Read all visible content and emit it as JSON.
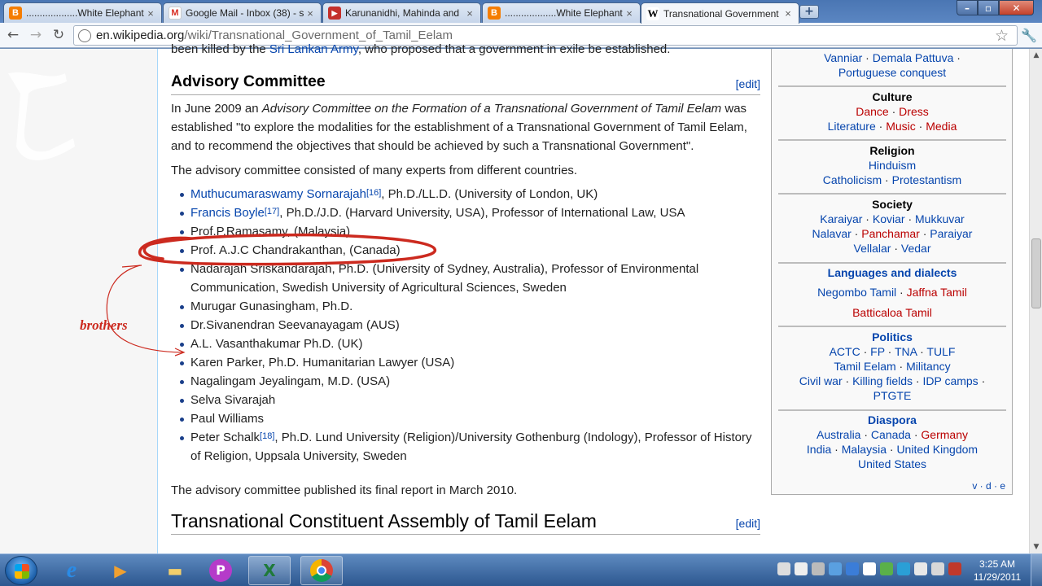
{
  "browser": {
    "tabs": [
      {
        "title": "...................White Elephant",
        "icon": "blogger-icon",
        "color": "#f57d00",
        "glyph": "B"
      },
      {
        "title": "Google Mail - Inbox (38) - s",
        "icon": "gmail-icon",
        "color": "#d93025",
        "glyph": "M"
      },
      {
        "title": "Karunanidhi, Mahinda and",
        "icon": "youtube-icon",
        "color": "#c4302b",
        "glyph": "▶"
      },
      {
        "title": "...................White Elephant",
        "icon": "blogger-icon",
        "color": "#f57d00",
        "glyph": "B"
      },
      {
        "title": "Transnational Government",
        "icon": "wikipedia-icon",
        "color": "#ffffff",
        "glyph": "W"
      }
    ],
    "url_host": "en.wikipedia.org",
    "url_path": "/wiki/Transnational_Government_of_Tamil_Eelam"
  },
  "article": {
    "top_line": {
      "pre": "been killed by the ",
      "link": "Sri Lankan Army",
      "post": ", who proposed that a government in exile be established."
    },
    "section1": {
      "title": "Advisory Committee",
      "edit": "[edit]"
    },
    "para1": {
      "pre": "In June 2009 an ",
      "italic": "Advisory Committee on the Formation of a Transnational Government of Tamil Eelam",
      "post": " was established \"to explore the modalities for the establishment of a Transnational Government of Tamil Eelam, and to recommend the objectives that should be achieved by such a Transnational Government\"."
    },
    "para2": "The advisory committee consisted of many experts from different countries.",
    "members": [
      {
        "link": "Muthucumaraswamy Sornarajah",
        "ref": "[16]",
        "text": ", Ph.D./LL.D. (University of London, UK)"
      },
      {
        "link": "Francis Boyle",
        "ref": "[17]",
        "text": ", Ph.D./J.D. (Harvard University, USA), Professor of International Law, USA"
      },
      {
        "text": "Prof.P.Ramasamy, (Malaysia)"
      },
      {
        "text": "Prof. A.J.C Chandrakanthan, (Canada)"
      },
      {
        "text": "Nadarajah Sriskandarajah, Ph.D. (University of Sydney, Australia), Professor of Environmental Communication, Swedish University of Agricultural Sciences, Sweden"
      },
      {
        "text": "Murugar Gunasingham, Ph.D."
      },
      {
        "text": "Dr.Sivanendran Seevanayagam (AUS)"
      },
      {
        "text": "A.L. Vasanthakumar Ph.D. (UK)"
      },
      {
        "text": "Karen Parker, Ph.D. Humanitarian Lawyer (USA)"
      },
      {
        "text": "Nagalingam Jeyalingam, M.D. (USA)"
      },
      {
        "text": "Selva Sivarajah"
      },
      {
        "text": "Paul Williams"
      },
      {
        "text": "Peter Schalk",
        "ref": "[18]",
        "text2": ", Ph.D. Lund University (Religion)/University Gothenburg (Indology), Professor of History of Religion, Uppsala University, Sweden"
      }
    ],
    "para3": "The advisory committee published its final report in March 2010.",
    "section2": {
      "title": "Transnational Constituent Assembly of Tamil Eelam",
      "edit": "[edit]"
    },
    "annotation": "brothers",
    "annotation_color": "#cc2a1f"
  },
  "navbox": {
    "history": {
      "row1": [
        "Vanniar",
        "Demala Pattuva"
      ],
      "row2": [
        "Portuguese conquest"
      ]
    },
    "culture": {
      "title": "Culture",
      "row1": [
        "Dance",
        "Dress"
      ],
      "row2": [
        "Literature",
        "Music",
        "Media"
      ]
    },
    "religion": {
      "title": "Religion",
      "row1": [
        "Hinduism"
      ],
      "row2": [
        "Catholicism",
        "Protestantism"
      ]
    },
    "society": {
      "title": "Society",
      "row1": [
        "Karaiyar",
        "Koviar",
        "Mukkuvar"
      ],
      "row2": [
        "Nalavar",
        "Panchamar",
        "Paraiyar"
      ],
      "row3": [
        "Vellalar",
        "Vedar"
      ]
    },
    "languages": {
      "title": "Languages and dialects",
      "row1": [
        "Negombo Tamil",
        "Jaffna Tamil"
      ],
      "row2": [
        "Batticaloa Tamil"
      ]
    },
    "politics": {
      "title": "Politics",
      "row1": [
        "ACTC",
        "FP",
        "TNA",
        "TULF"
      ],
      "row2": [
        "Tamil Eelam",
        "Militancy"
      ],
      "row3": [
        "Civil war",
        "Killing fields",
        "IDP camps"
      ],
      "row4": [
        "PTGTE"
      ]
    },
    "diaspora": {
      "title": "Diaspora",
      "row1": [
        "Australia",
        "Canada",
        "Germany"
      ],
      "row2": [
        "India",
        "Malaysia",
        "United Kingdom"
      ],
      "row3": [
        "United States"
      ]
    },
    "vde": "v · d · e"
  },
  "taskbar": {
    "time": "3:25 AM",
    "date": "11/29/2011"
  }
}
